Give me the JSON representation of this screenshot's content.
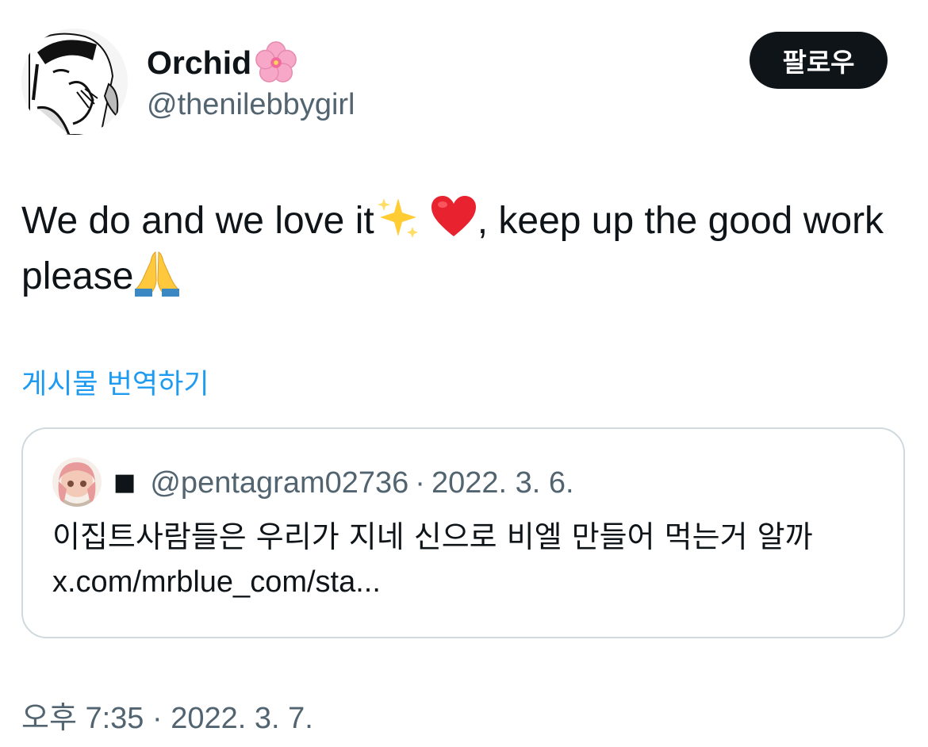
{
  "author": {
    "display_name": "Orchid",
    "name_emoji": "cherry-blossom-icon",
    "handle": "@thenilebbygirl",
    "avatar": "manga-avatar"
  },
  "follow_button": {
    "label": "팔로우"
  },
  "tweet": {
    "text_part1": "We do and we love it",
    "emoji1": "sparkles-icon",
    "emoji2": "red-heart-icon",
    "text_part2": ", keep up the good work please",
    "emoji3": "folded-hands-icon"
  },
  "translate_link": "게시물 번역하기",
  "quoted_tweet": {
    "name_glyph": "■",
    "handle": "@pentagram02736",
    "separator": "·",
    "date": "2022. 3. 6.",
    "text": "이집트사람들은 우리가 지네 신으로 비엘 만들어 먹는거 알까",
    "link": "x.com/mrblue_com/sta..."
  },
  "timestamp": {
    "period": "오후",
    "time": "7:35",
    "separator": "·",
    "date": "2022. 3. 7."
  },
  "colors": {
    "text": "#0f1419",
    "secondary": "#536471",
    "link": "#1d9bf0",
    "border": "#cfd9de",
    "button_bg": "#0f1419"
  }
}
